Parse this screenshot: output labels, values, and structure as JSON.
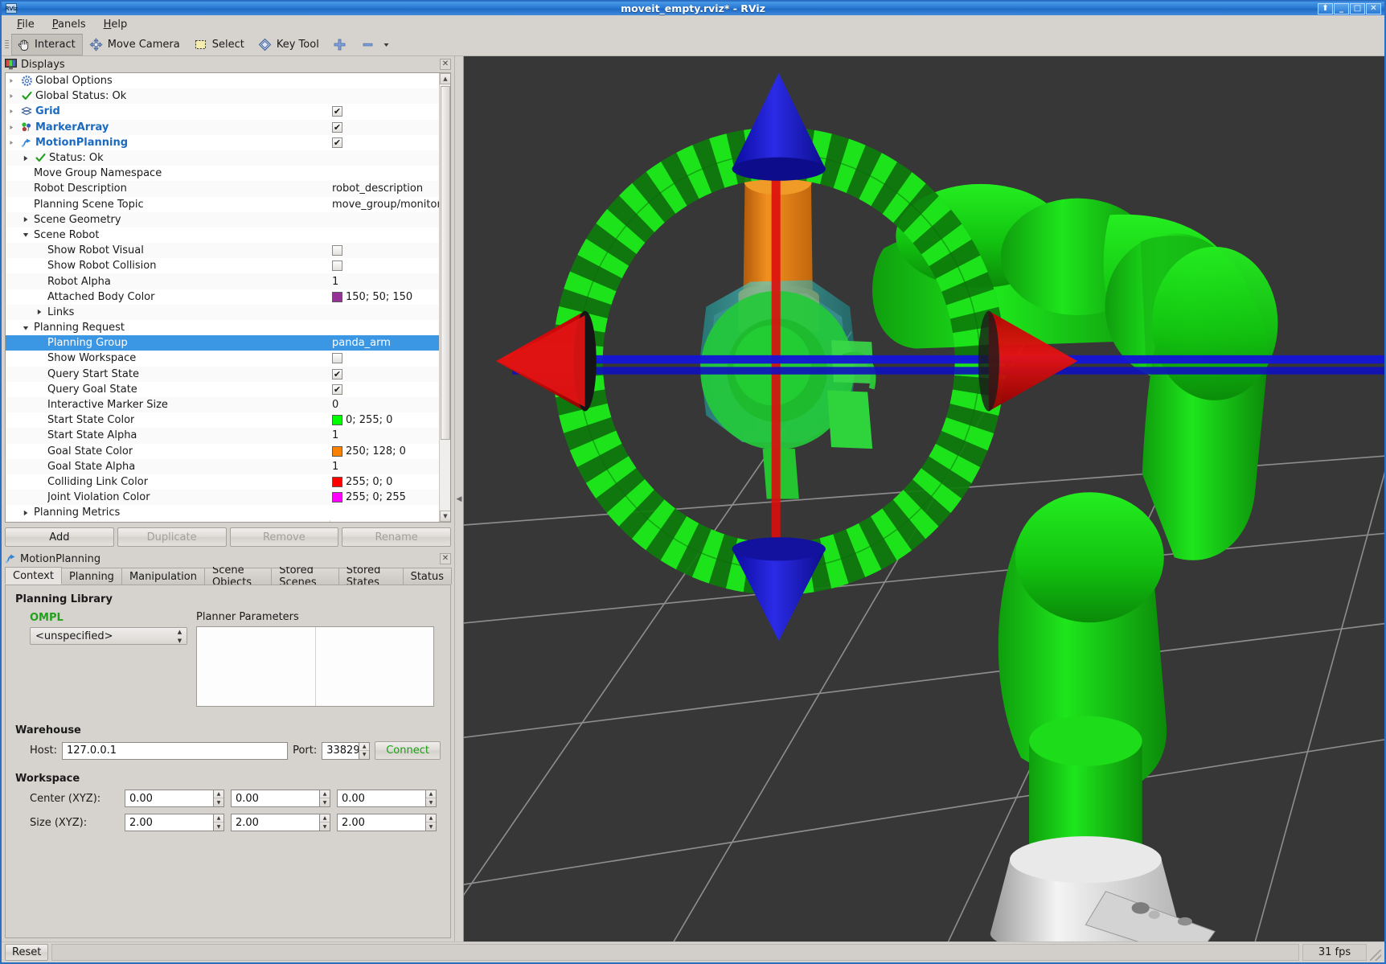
{
  "window": {
    "title": "moveit_empty.rviz* - RViz",
    "app_icon_text": "RViz",
    "buttons": {
      "shade": "⬆",
      "minimize": "_",
      "maximize": "□",
      "close": "✕"
    }
  },
  "menubar": {
    "items": [
      "File",
      "Panels",
      "Help"
    ]
  },
  "toolbar": {
    "items": [
      {
        "label": "Interact",
        "icon": "hand-cursor-icon",
        "checked": true
      },
      {
        "label": "Move Camera",
        "icon": "move-camera-icon",
        "checked": false
      },
      {
        "label": "Select",
        "icon": "select-rect-icon",
        "checked": false
      },
      {
        "label": "Key Tool",
        "icon": "key-tool-icon",
        "checked": false
      },
      {
        "label": "",
        "icon": "plus-icon",
        "checked": false
      },
      {
        "label": "",
        "icon": "minus-icon",
        "checked": false
      }
    ]
  },
  "displays_panel": {
    "title": "Displays",
    "close_label": "✕",
    "rows": [
      {
        "indent": 0,
        "disclosure": "dot",
        "icon": "gear-icon",
        "label": "Global Options",
        "style": "plain",
        "value_type": "none"
      },
      {
        "indent": 0,
        "disclosure": "dot",
        "icon": "check-icon",
        "label": "Global Status: Ok",
        "style": "plain",
        "value_type": "none"
      },
      {
        "indent": 0,
        "disclosure": "dot",
        "icon": "grid-icon",
        "label": "Grid",
        "style": "blue",
        "value_type": "checkbox",
        "checked": true
      },
      {
        "indent": 0,
        "disclosure": "dot",
        "icon": "markerarray-icon",
        "label": "MarkerArray",
        "style": "blue",
        "value_type": "checkbox",
        "checked": true
      },
      {
        "indent": 0,
        "disclosure": "dot",
        "icon": "motionplan-icon",
        "label": "MotionPlanning",
        "style": "blue",
        "value_type": "checkbox",
        "checked": true
      },
      {
        "indent": 1,
        "disclosure": "right",
        "icon": "check-icon",
        "label": "Status: Ok",
        "style": "plain",
        "value_type": "none"
      },
      {
        "indent": 1,
        "disclosure": "none",
        "icon": "none",
        "label": "Move Group Namespace",
        "style": "plain",
        "value_type": "none"
      },
      {
        "indent": 1,
        "disclosure": "none",
        "icon": "none",
        "label": "Robot Description",
        "style": "plain",
        "value_type": "text",
        "value": "robot_description"
      },
      {
        "indent": 1,
        "disclosure": "none",
        "icon": "none",
        "label": "Planning Scene Topic",
        "style": "plain",
        "value_type": "text",
        "value": "move_group/monitored_..."
      },
      {
        "indent": 1,
        "disclosure": "right",
        "icon": "none",
        "label": "Scene Geometry",
        "style": "plain",
        "value_type": "none"
      },
      {
        "indent": 1,
        "disclosure": "down",
        "icon": "none",
        "label": "Scene Robot",
        "style": "plain",
        "value_type": "none"
      },
      {
        "indent": 2,
        "disclosure": "none",
        "icon": "none",
        "label": "Show Robot Visual",
        "style": "plain",
        "value_type": "checkbox",
        "checked": false
      },
      {
        "indent": 2,
        "disclosure": "none",
        "icon": "none",
        "label": "Show Robot Collision",
        "style": "plain",
        "value_type": "checkbox",
        "checked": false
      },
      {
        "indent": 2,
        "disclosure": "none",
        "icon": "none",
        "label": "Robot Alpha",
        "style": "plain",
        "value_type": "text",
        "value": "1"
      },
      {
        "indent": 2,
        "disclosure": "none",
        "icon": "none",
        "label": "Attached Body Color",
        "style": "plain",
        "value_type": "color",
        "value": "150; 50; 150",
        "color": "#963296"
      },
      {
        "indent": 2,
        "disclosure": "right",
        "icon": "none",
        "label": "Links",
        "style": "plain",
        "value_type": "none"
      },
      {
        "indent": 1,
        "disclosure": "down",
        "icon": "none",
        "label": "Planning Request",
        "style": "plain",
        "value_type": "none"
      },
      {
        "indent": 2,
        "disclosure": "none",
        "icon": "none",
        "label": "Planning Group",
        "style": "plain",
        "value_type": "text",
        "value": "panda_arm",
        "selected": true
      },
      {
        "indent": 2,
        "disclosure": "none",
        "icon": "none",
        "label": "Show Workspace",
        "style": "plain",
        "value_type": "checkbox",
        "checked": false
      },
      {
        "indent": 2,
        "disclosure": "none",
        "icon": "none",
        "label": "Query Start State",
        "style": "plain",
        "value_type": "checkbox",
        "checked": true
      },
      {
        "indent": 2,
        "disclosure": "none",
        "icon": "none",
        "label": "Query Goal State",
        "style": "plain",
        "value_type": "checkbox",
        "checked": true
      },
      {
        "indent": 2,
        "disclosure": "none",
        "icon": "none",
        "label": "Interactive Marker Size",
        "style": "plain",
        "value_type": "text",
        "value": "0"
      },
      {
        "indent": 2,
        "disclosure": "none",
        "icon": "none",
        "label": "Start State Color",
        "style": "plain",
        "value_type": "color",
        "value": "0; 255; 0",
        "color": "#00ff00"
      },
      {
        "indent": 2,
        "disclosure": "none",
        "icon": "none",
        "label": "Start State Alpha",
        "style": "plain",
        "value_type": "text",
        "value": "1"
      },
      {
        "indent": 2,
        "disclosure": "none",
        "icon": "none",
        "label": "Goal State Color",
        "style": "plain",
        "value_type": "color",
        "value": "250; 128; 0",
        "color": "#fa8000"
      },
      {
        "indent": 2,
        "disclosure": "none",
        "icon": "none",
        "label": "Goal State Alpha",
        "style": "plain",
        "value_type": "text",
        "value": "1"
      },
      {
        "indent": 2,
        "disclosure": "none",
        "icon": "none",
        "label": "Colliding Link Color",
        "style": "plain",
        "value_type": "color",
        "value": "255; 0; 0",
        "color": "#ff0000"
      },
      {
        "indent": 2,
        "disclosure": "none",
        "icon": "none",
        "label": "Joint Violation Color",
        "style": "plain",
        "value_type": "color",
        "value": "255; 0; 255",
        "color": "#ff00ff"
      },
      {
        "indent": 1,
        "disclosure": "right",
        "icon": "none",
        "label": "Planning Metrics",
        "style": "plain",
        "value_type": "none"
      }
    ],
    "buttons": [
      {
        "label": "Add",
        "enabled": true
      },
      {
        "label": "Duplicate",
        "enabled": false
      },
      {
        "label": "Remove",
        "enabled": false
      },
      {
        "label": "Rename",
        "enabled": false
      }
    ]
  },
  "motion_planning": {
    "title": "MotionPlanning",
    "close_label": "✕",
    "tabs": [
      {
        "label": "Context",
        "active": true
      },
      {
        "label": "Planning",
        "active": false
      },
      {
        "label": "Manipulation",
        "active": false
      },
      {
        "label": "Scene Objects",
        "active": false
      },
      {
        "label": "Stored Scenes",
        "active": false
      },
      {
        "label": "Stored States",
        "active": false
      },
      {
        "label": "Status",
        "active": false
      }
    ],
    "context": {
      "planning_library_title": "Planning Library",
      "ompl_label": "OMPL",
      "planner_select_value": "<unspecified>",
      "planner_parameters_label": "Planner Parameters",
      "warehouse_title": "Warehouse",
      "host_label": "Host:",
      "host_value": "127.0.0.1",
      "port_label": "Port:",
      "port_value": "33829",
      "connect_label": "Connect",
      "connect_color": "#17a00f",
      "workspace_title": "Workspace",
      "center_label": "Center (XYZ):",
      "center_values": [
        "0.00",
        "0.00",
        "0.00"
      ],
      "size_label": "Size (XYZ):",
      "size_values": [
        "2.00",
        "2.00",
        "2.00"
      ]
    }
  },
  "view3d": {
    "background_color": "#373737",
    "grid_color": "#9b9b9b",
    "splitter_arrow": "◀",
    "scene_description": "MoveIt RViz 3D scene: Panda robot arm rendered in green with an orange goal-state link, a cyan-highlighted collision body, and an interactive 6-DOF marker composed of red/blue arrow cones and a green striped rotation ring",
    "markers": {
      "ring_color": "#22c81e",
      "ring_dark_color": "#0f8a0c",
      "x_axis_color": "#cc0000",
      "z_axis_color": "#1414c8",
      "y_axis_color": "#1414cd",
      "robot_color": "#14d814",
      "goal_color": "#e8821a",
      "collision_color": "#2fc5c5",
      "base_color": "#e8e8e8"
    }
  },
  "statusbar": {
    "reset_label": "Reset",
    "message": "",
    "fps": "31 fps"
  }
}
